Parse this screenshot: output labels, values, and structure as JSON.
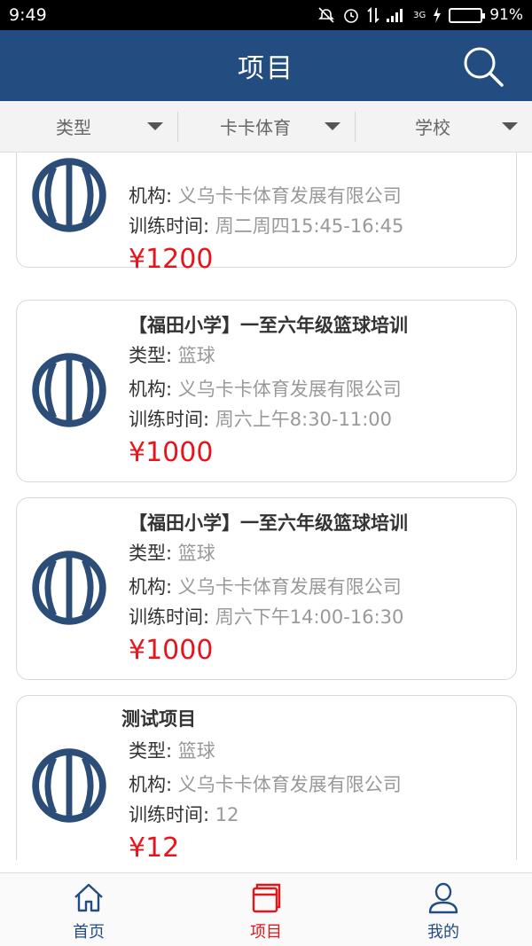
{
  "status_bar": {
    "time": "9:49",
    "network": "3G",
    "battery_text": "91%",
    "battery_level": 0.91
  },
  "header": {
    "title": "项目",
    "search_icon": "search-icon"
  },
  "filters": [
    {
      "label": "类型"
    },
    {
      "label": "卡卡体育"
    },
    {
      "label": "学校"
    }
  ],
  "items": [
    {
      "org_key": "机构:",
      "org": "义乌卡卡体育发展有限公司",
      "time_key": "训练时间:",
      "time": "周二周四15:45-16:45",
      "price": "¥1200"
    },
    {
      "title": "【福田小学】一至六年级篮球培训",
      "type_key": "类型:",
      "type": "篮球",
      "org_key": "机构:",
      "org": "义乌卡卡体育发展有限公司",
      "time_key": "训练时间:",
      "time": "周六上午8:30-11:00",
      "price": "¥1000"
    },
    {
      "title": "【福田小学】一至六年级篮球培训",
      "type_key": "类型:",
      "type": "篮球",
      "org_key": "机构:",
      "org": "义乌卡卡体育发展有限公司",
      "time_key": "训练时间:",
      "time": "周六下午14:00-16:30",
      "price": "¥1000"
    },
    {
      "title": "测试项目",
      "type_key": "类型:",
      "type": "篮球",
      "org_key": "机构:",
      "org": "义乌卡卡体育发展有限公司",
      "time_key": "训练时间:",
      "time": "12",
      "price": "¥12"
    }
  ],
  "tabs": [
    {
      "label": "首页",
      "icon": "home-icon"
    },
    {
      "label": "项目",
      "icon": "project-icon",
      "active": true
    },
    {
      "label": "我的",
      "icon": "user-icon"
    }
  ],
  "colors": {
    "primary": "#234c80",
    "price": "#e8141b",
    "active_tab": "#e8141b"
  }
}
